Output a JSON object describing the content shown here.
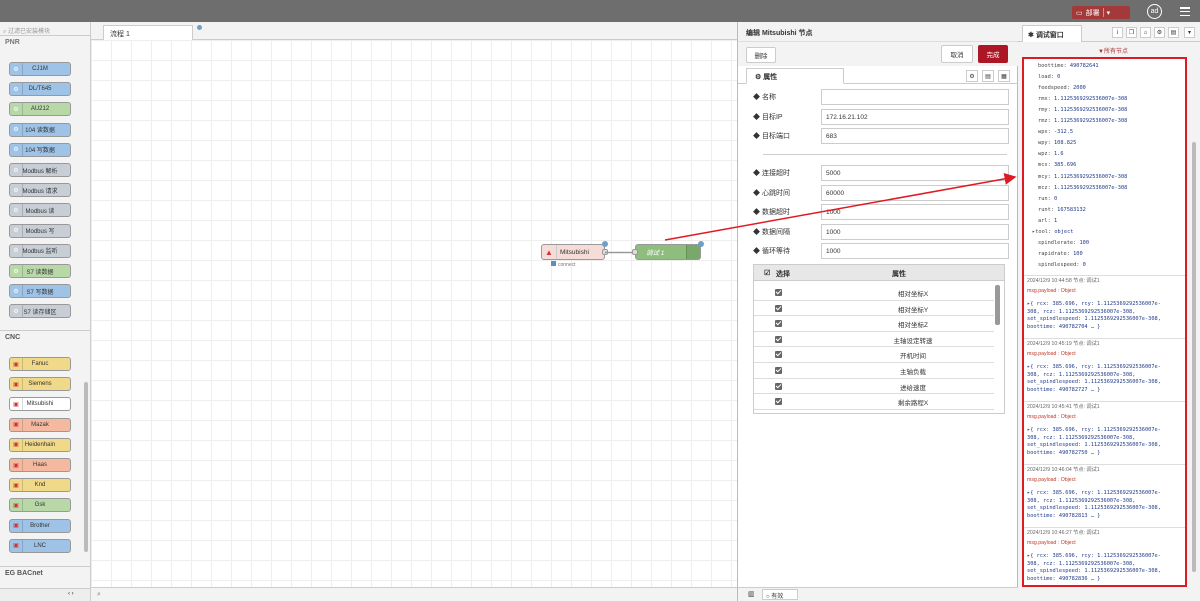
{
  "header": {
    "deploy_label": "部署",
    "user_initials": "ad"
  },
  "palette": {
    "search_placeholder": "过滤已安装模块",
    "category_top": "PNR",
    "nodes_top": [
      "CJ1M",
      "DL/T645",
      "AU212",
      "104 读数据",
      "104 写数据",
      "Modbus 解析",
      "Modbus 请求",
      "Modbus 读",
      "Modbus 写",
      "Modbus 监听",
      "S7 读数据",
      "S7 写数据",
      "S7 读存储区"
    ],
    "category_cnc": "CNC",
    "nodes_cnc": [
      "Fanuc",
      "Siemens",
      "Mitsubishi",
      "Mazak",
      "Heidenhain",
      "Haas",
      "Knd",
      "Gsk",
      "Brother",
      "LNC"
    ],
    "category_bottom": "EG BACnet"
  },
  "workspace": {
    "tab_label": "流程 1",
    "node1_label": "Mitsubishi",
    "node1_status": "connect",
    "node2_label": "调试 1"
  },
  "tray": {
    "title": "编辑 Mitsubishi 节点",
    "delete_label": "删除",
    "cancel_label": "取消",
    "done_label": "完成",
    "tab_properties": "属性",
    "fields": [
      {
        "label": "名称",
        "value": ""
      },
      {
        "label": "目标IP",
        "value": "172.16.21.102"
      },
      {
        "label": "目标端口",
        "value": "683"
      }
    ],
    "fields2": [
      {
        "label": "连接超时",
        "value": "5000"
      },
      {
        "label": "心跳时间",
        "value": "60000"
      },
      {
        "label": "数据超时",
        "value": "1000"
      },
      {
        "label": "数据间隔",
        "value": "1000"
      },
      {
        "label": "循环等待",
        "value": "1000"
      }
    ],
    "table": {
      "col_select": "选择",
      "col_property": "属性",
      "rows": [
        "相对坐标X",
        "相对坐标Y",
        "相对坐标Z",
        "主轴设定转速",
        "开机时间",
        "主轴负载",
        "进给速度",
        "剩余路程X"
      ]
    },
    "footer_enabled": "有效"
  },
  "sidebar": {
    "tab_label": "调试窗口",
    "filter_label": "所有节点",
    "top_values": [
      {
        "k": "boottime",
        "v": "490782641"
      },
      {
        "k": "load",
        "v": "0"
      },
      {
        "k": "feedspeed",
        "v": "2000"
      },
      {
        "k": "rmx",
        "v": "1.1125369292536007e-308"
      },
      {
        "k": "rmy",
        "v": "1.1125369292536007e-308"
      },
      {
        "k": "rmz",
        "v": "1.1125369292536007e-308"
      },
      {
        "k": "wpx",
        "v": "-312.5"
      },
      {
        "k": "wpy",
        "v": "108.825"
      },
      {
        "k": "wpz",
        "v": "1.6"
      },
      {
        "k": "mcx",
        "v": "385.696"
      },
      {
        "k": "mcy",
        "v": "1.1125369292536007e-308"
      },
      {
        "k": "mcz",
        "v": "1.1125369292536007e-308"
      },
      {
        "k": "run",
        "v": "0"
      },
      {
        "k": "runt",
        "v": "167583132"
      },
      {
        "k": "arl",
        "v": "1"
      },
      {
        "k": "▸tool",
        "v": "object"
      },
      {
        "k": "spindlerate",
        "v": "100"
      },
      {
        "k": "rapidrate",
        "v": "100"
      },
      {
        "k": "spindlespeed",
        "v": "0"
      }
    ],
    "messages": [
      {
        "head": "2024/12/9 10:44:58   节点: 调试1",
        "type": "msg.payload : Object",
        "body": "▸{ rcx: 385.696, rcy: 1.1125369292536007e-\n308, rcz: 1.1125369292536007e-308,\nset_spindlespeed: 1.1125369292536007e-308,\nboottime: 490782704 … }"
      },
      {
        "head": "2024/12/9 10:45:19   节点: 调试1",
        "type": "msg.payload : Object",
        "body": "▸{ rcx: 385.696, rcy: 1.1125369292536007e-\n308, rcz: 1.1125369292536007e-308,\nset_spindlespeed: 1.1125369292536007e-308,\nboottime: 490782727 … }"
      },
      {
        "head": "2024/12/9 10:45:41   节点: 调试1",
        "type": "msg.payload : Object",
        "body": "▸{ rcx: 385.696, rcy: 1.1125369292536007e-\n308, rcz: 1.1125369292536007e-308,\nset_spindlespeed: 1.1125369292536007e-308,\nboottime: 490782750 … }"
      },
      {
        "head": "2024/12/9 10:46:04   节点: 调试1",
        "type": "msg.payload : Object",
        "body": "▸{ rcx: 385.696, rcy: 1.1125369292536007e-\n308, rcz: 1.1125369292536007e-308,\nset_spindlespeed: 1.1125369292536007e-308,\nboottime: 490782813 … }"
      },
      {
        "head": "2024/12/9 10:46:27   节点: 调试1",
        "type": "msg.payload : Object",
        "body": "▸{ rcx: 385.696, rcy: 1.1125369292536007e-\n308, rcz: 1.1125369292536007e-308,\nset_spindlespeed: 1.1125369292536007e-308,\nboottime: 490782836 … }"
      }
    ]
  },
  "colors": {
    "accent": "#ad1625",
    "highlight": "#e01a22",
    "node_green": "#8fbd7e",
    "node_mitsu": "#f5dcd7"
  }
}
